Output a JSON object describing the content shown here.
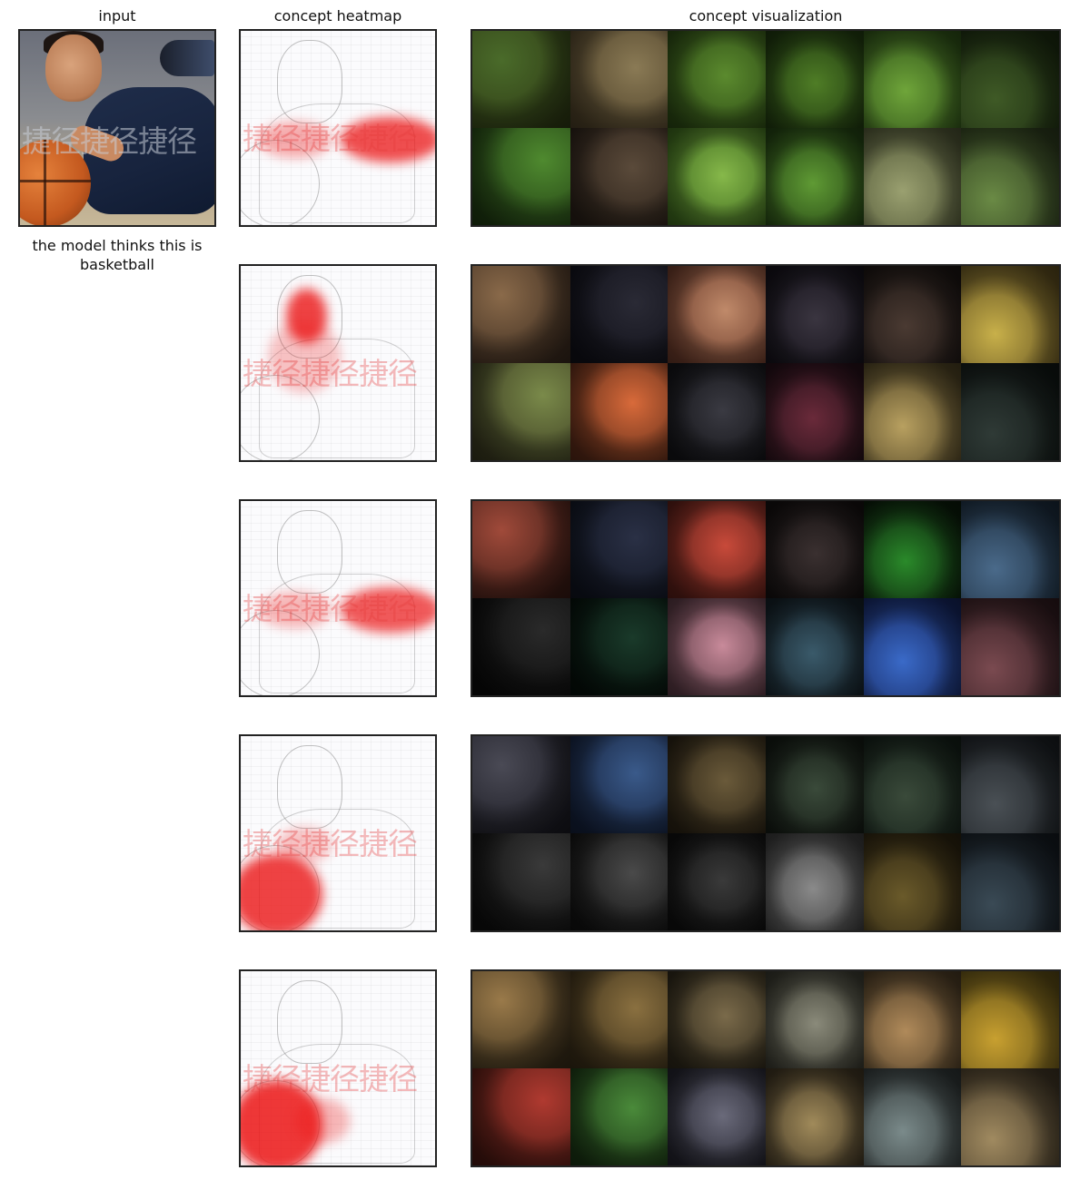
{
  "headers": {
    "input": "input",
    "heatmap": "concept heatmap",
    "visualization": "concept visualization"
  },
  "input_image": {
    "watermark": "捷径捷径捷径",
    "description_icon": "basketball-player-photo"
  },
  "caption": "the model thinks this is basketball",
  "heatmap_watermark": "捷径捷径捷径",
  "concepts": [
    {
      "id": "concept-1",
      "tiles": [
        [
          "#4a6b2a",
          "#2e3a14"
        ],
        [
          "#8a7a55",
          "#4d4028"
        ],
        [
          "#5b8a2e",
          "#2c4a14"
        ],
        [
          "#4f7d26",
          "#203a10"
        ],
        [
          "#6fa53a",
          "#2d4f17"
        ],
        [
          "#3f5a26",
          "#1b2a10"
        ],
        [
          "#4f8a2f",
          "#1f3b12"
        ],
        [
          "#5a4a3a",
          "#2a2018"
        ],
        [
          "#86b84a",
          "#3f6a1f"
        ],
        [
          "#5f9a34",
          "#234213"
        ],
        [
          "#9aa070",
          "#4c5233"
        ],
        [
          "#6a8a45",
          "#2c3a1d"
        ]
      ]
    },
    {
      "id": "concept-2",
      "tiles": [
        [
          "#8a6a4a",
          "#3a2a1e"
        ],
        [
          "#2a2a35",
          "#101018"
        ],
        [
          "#c08a6a",
          "#6a3a2a"
        ],
        [
          "#3a3540",
          "#15121a"
        ],
        [
          "#4a3a32",
          "#1a1412"
        ],
        [
          "#c8b04a",
          "#5a4a1e"
        ],
        [
          "#7a8a4a",
          "#3a3a20"
        ],
        [
          "#d86a3a",
          "#5a2a18"
        ],
        [
          "#3a3a42",
          "#141418"
        ],
        [
          "#6a2a3a",
          "#241018"
        ],
        [
          "#b8a060",
          "#4a3f22"
        ],
        [
          "#2f3a36",
          "#101614"
        ]
      ]
    },
    {
      "id": "concept-3",
      "tiles": [
        [
          "#a04a3a",
          "#3a1a14"
        ],
        [
          "#2a3045",
          "#101420"
        ],
        [
          "#c84a3a",
          "#5a1e18"
        ],
        [
          "#3a3030",
          "#141010"
        ],
        [
          "#2a8a2a",
          "#0a1a0a"
        ],
        [
          "#4a6a8a",
          "#1a2a3a"
        ],
        [
          "#2a2a2a",
          "#0a0a0a"
        ],
        [
          "#1a3a2a",
          "#050f0a"
        ],
        [
          "#c88a9a",
          "#5a3a44"
        ],
        [
          "#3a5a6a",
          "#141f26"
        ],
        [
          "#3a6ac8",
          "#14245a"
        ],
        [
          "#7a4a50",
          "#2e1a1e"
        ]
      ]
    },
    {
      "id": "concept-4",
      "tiles": [
        [
          "#4a4a55",
          "#1a1a22"
        ],
        [
          "#3a5a8a",
          "#14203a"
        ],
        [
          "#6a5a3a",
          "#2a2214"
        ],
        [
          "#3a4a3a",
          "#141a14"
        ],
        [
          "#3a4a3a",
          "#141f18"
        ],
        [
          "#4a5055",
          "#1a1e22"
        ],
        [
          "#3a3a3a",
          "#0e0e0e"
        ],
        [
          "#4a4a4a",
          "#121212"
        ],
        [
          "#3a3a3a",
          "#101010"
        ],
        [
          "#8a8a8a",
          "#3a3a3a"
        ],
        [
          "#6a5a2a",
          "#2a2210"
        ],
        [
          "#3a4a55",
          "#141a20"
        ]
      ]
    },
    {
      "id": "concept-5",
      "tiles": [
        [
          "#9a7a4a",
          "#3a2e1a"
        ],
        [
          "#8a7040",
          "#3a2e18"
        ],
        [
          "#7a6a4a",
          "#2e281a"
        ],
        [
          "#8a8a7a",
          "#3a3a30"
        ],
        [
          "#b08a5a",
          "#4a3a24"
        ],
        [
          "#c8a030",
          "#5a4a14"
        ],
        [
          "#b03a30",
          "#4a1812"
        ],
        [
          "#4a8a3a",
          "#1a3614"
        ],
        [
          "#6a6a7a",
          "#24242e"
        ],
        [
          "#a08a5a",
          "#3e3422"
        ],
        [
          "#7a8a8a",
          "#2e3434"
        ],
        [
          "#a08a60",
          "#3e3424"
        ]
      ]
    }
  ]
}
